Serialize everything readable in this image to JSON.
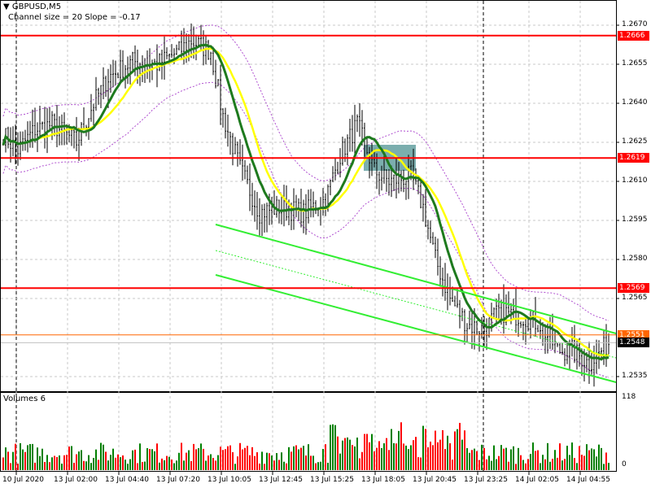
{
  "header": {
    "symbol": "GBPUSD,M5",
    "indicator": "Channel size = 20 Slope = -0.17",
    "volumes_label": "Volumes 6"
  },
  "colors": {
    "level": "#ff0000",
    "bid": "#ff6600",
    "current": "#000000",
    "ma_fast": "#ffff00",
    "ma_slow": "#1e7a1e",
    "channel": "#33ee33",
    "envelope": "#b050d0",
    "vol_up": "#008000",
    "vol_down": "#ff0000"
  },
  "price_axis": {
    "ticks": [
      "1.2670",
      "1.2655",
      "1.2640",
      "1.2625",
      "1.2610",
      "1.2595",
      "1.2580",
      "1.2565",
      "1.2535"
    ],
    "range": [
      1.2535,
      1.267
    ]
  },
  "levels": [
    {
      "price": 1.2666,
      "label": "1.2666"
    },
    {
      "price": 1.2619,
      "label": "1.2619"
    },
    {
      "price": 1.2569,
      "label": "1.2569"
    }
  ],
  "bid": {
    "price": 1.2551,
    "label": "1.2551"
  },
  "current": {
    "price": 1.2548,
    "label": "1.2548"
  },
  "volume_axis": {
    "max_label": "118",
    "min_label": "0",
    "max": 118
  },
  "time_axis": [
    "10 Jul 2020",
    "13 Jul 02:00",
    "13 Jul 04:40",
    "13 Jul 07:20",
    "13 Jul 10:05",
    "13 Jul 12:45",
    "13 Jul 15:25",
    "13 Jul 18:05",
    "13 Jul 20:45",
    "13 Jul 23:25",
    "14 Jul 02:05",
    "14 Jul 04:55"
  ],
  "chart_data": {
    "type": "candlestick",
    "title": "GBPUSD,M5",
    "price_path": [
      [
        0,
        1.2628
      ],
      [
        6,
        1.2622
      ],
      [
        13,
        1.263
      ],
      [
        20,
        1.2632
      ],
      [
        30,
        1.2625
      ],
      [
        37,
        1.264
      ],
      [
        43,
        1.265
      ],
      [
        53,
        1.2656
      ],
      [
        63,
        1.2655
      ],
      [
        72,
        1.266
      ],
      [
        77,
        1.2664
      ],
      [
        85,
        1.266
      ],
      [
        90,
        1.2635
      ],
      [
        97,
        1.2615
      ],
      [
        105,
        1.2598
      ],
      [
        113,
        1.26
      ],
      [
        123,
        1.2598
      ],
      [
        132,
        1.2603
      ],
      [
        138,
        1.262
      ],
      [
        145,
        1.2632
      ],
      [
        152,
        1.2614
      ],
      [
        158,
        1.261
      ],
      [
        167,
        1.2612
      ],
      [
        172,
        1.26
      ],
      [
        177,
        1.258
      ],
      [
        183,
        1.2565
      ],
      [
        190,
        1.2555
      ],
      [
        197,
        1.2553
      ],
      [
        203,
        1.256
      ],
      [
        213,
        1.2558
      ],
      [
        220,
        1.2555
      ],
      [
        227,
        1.2545
      ],
      [
        233,
        1.2545
      ],
      [
        240,
        1.254
      ],
      [
        248,
        1.2548
      ]
    ]
  }
}
